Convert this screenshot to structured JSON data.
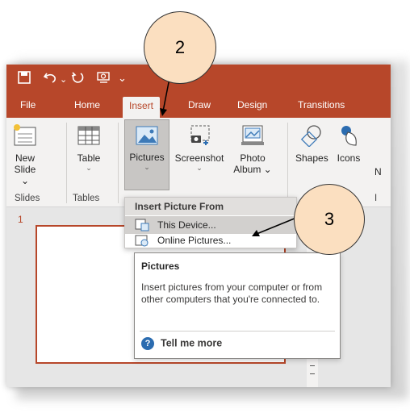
{
  "qat": {
    "save_icon": "save-icon",
    "undo_icon": "undo-icon",
    "redo_icon": "redo-icon",
    "dropdown_glyph": "⌄"
  },
  "tabs": [
    "File",
    "Home",
    "Insert",
    "Draw",
    "Design",
    "Transitions"
  ],
  "ribbon": {
    "new_slide": {
      "line1": "New",
      "line2": "Slide ⌄"
    },
    "table": {
      "label": "Table",
      "chev": "⌄"
    },
    "pictures": {
      "label": "Pictures",
      "chev": "⌄"
    },
    "screenshot": {
      "label": "Screenshot",
      "chev": "⌄"
    },
    "photo_album": {
      "line1": "Photo",
      "line2": "Album ⌄"
    },
    "shapes": {
      "label": "Shapes"
    },
    "icons": {
      "label": "Icons"
    },
    "cut_letter": "N",
    "groups": {
      "slides": "Slides",
      "tables": "Tables",
      "cut": "I"
    }
  },
  "slide_pane": {
    "slide_number": "1"
  },
  "dropdown": {
    "header": "Insert Picture From",
    "items": [
      "This Device...",
      "Online Pictures..."
    ]
  },
  "tooltip": {
    "title": "Pictures",
    "body": "Insert pictures from your computer or from other computers that you're connected to.",
    "link": "Tell me more"
  },
  "callouts": {
    "step2": "2",
    "step3": "3"
  },
  "colors": {
    "accent": "#b7472a",
    "callout_fill": "#fbdfc0"
  }
}
